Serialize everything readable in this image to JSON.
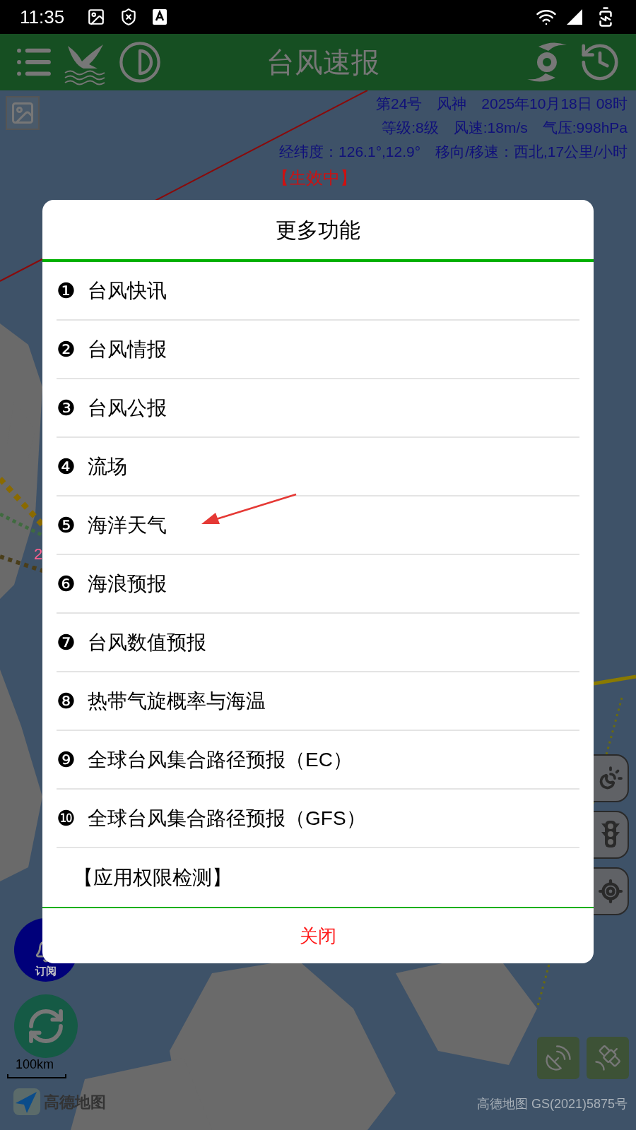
{
  "status_bar": {
    "time": "11:35"
  },
  "app_bar": {
    "title": "台风速报"
  },
  "typhoon_info": {
    "lines": [
      "第24号　风神　2025年10月18日 08时",
      "等级:8级　风速:18m/s　气压:998hPa",
      "经纬度：126.1°,12.9°　移向/移速：西北,17公里/小时"
    ],
    "status": "【生效中】"
  },
  "map": {
    "track_label": "2",
    "subscribe_label": "订阅",
    "scale": "100km",
    "logo": "高德地图",
    "copyright": "高德地图 GS(2021)5875号"
  },
  "dialog": {
    "title": "更多功能",
    "items": [
      {
        "number": "❶",
        "label": "台风快讯"
      },
      {
        "number": "❷",
        "label": "台风情报"
      },
      {
        "number": "❸",
        "label": "台风公报"
      },
      {
        "number": "❹",
        "label": "流场"
      },
      {
        "number": "❺",
        "label": "海洋天气"
      },
      {
        "number": "❻",
        "label": "海浪预报"
      },
      {
        "number": "❼",
        "label": "台风数值预报"
      },
      {
        "number": "❽",
        "label": "热带气旋概率与海温"
      },
      {
        "number": "❾",
        "label": "全球台风集合路径预报（EC）"
      },
      {
        "number": "❿",
        "label": "全球台风集合路径预报（GFS）"
      },
      {
        "label": "【应用权限检测】"
      }
    ],
    "close": "关闭"
  }
}
